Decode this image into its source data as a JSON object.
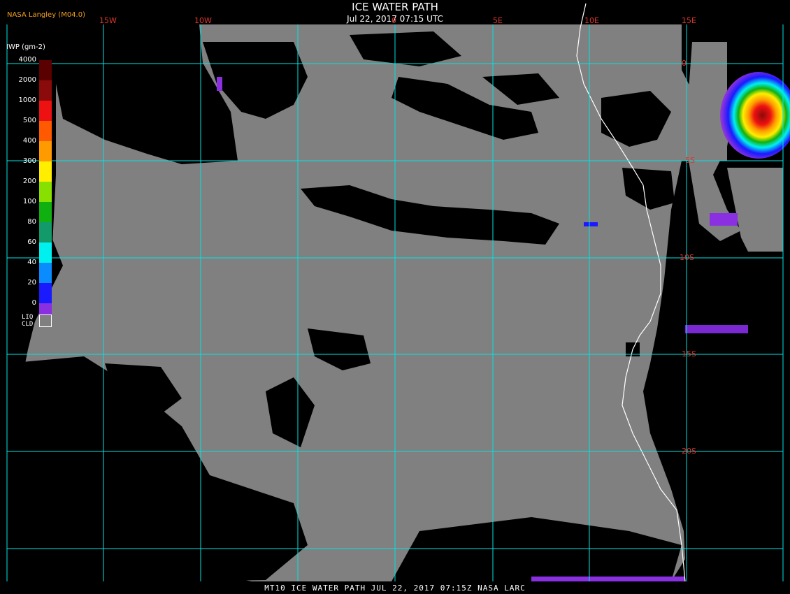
{
  "header": {
    "title": "ICE WATER PATH",
    "subtitle": "Jul 22, 2017 07:15 UTC",
    "agency": "NASA Langley (M04.0)"
  },
  "grid": {
    "lon_labels": [
      "15W",
      "10W",
      "0",
      "5E",
      "10E",
      "15E"
    ],
    "lat_labels": [
      "0",
      "5S",
      "10S",
      "15S",
      "20S"
    ],
    "line_color": "#00e5e5",
    "label_color": "#e0352b"
  },
  "legend": {
    "title": "IWP (gm-2)",
    "levels": [
      {
        "label": "4000",
        "color": "#5a0000"
      },
      {
        "label": "2000",
        "color": "#8b0a0a"
      },
      {
        "label": "1000",
        "color": "#ee1111"
      },
      {
        "label": "500",
        "color": "#ff5a00"
      },
      {
        "label": "400",
        "color": "#ff9a00"
      },
      {
        "label": "300",
        "color": "#ffee00"
      },
      {
        "label": "200",
        "color": "#88e000"
      },
      {
        "label": "100",
        "color": "#10b010"
      },
      {
        "label": "80",
        "color": "#129a6a"
      },
      {
        "label": "60",
        "color": "#00f0f0"
      },
      {
        "label": "40",
        "color": "#0a8cff"
      },
      {
        "label": "20",
        "color": "#1a1aff"
      },
      {
        "label": "0",
        "color": "#8a30e0"
      }
    ],
    "liquid_cloud": {
      "line1": "LIQ",
      "line2": "CLD",
      "color": "#808080"
    }
  },
  "footer": "MT10  ICE WATER PATH   JUL 22, 2017 07:15Z   NASA LARC",
  "colors": {
    "liquid_cloud": "#808080",
    "clear_sky": "#000000",
    "coastline": "#ffffff"
  }
}
